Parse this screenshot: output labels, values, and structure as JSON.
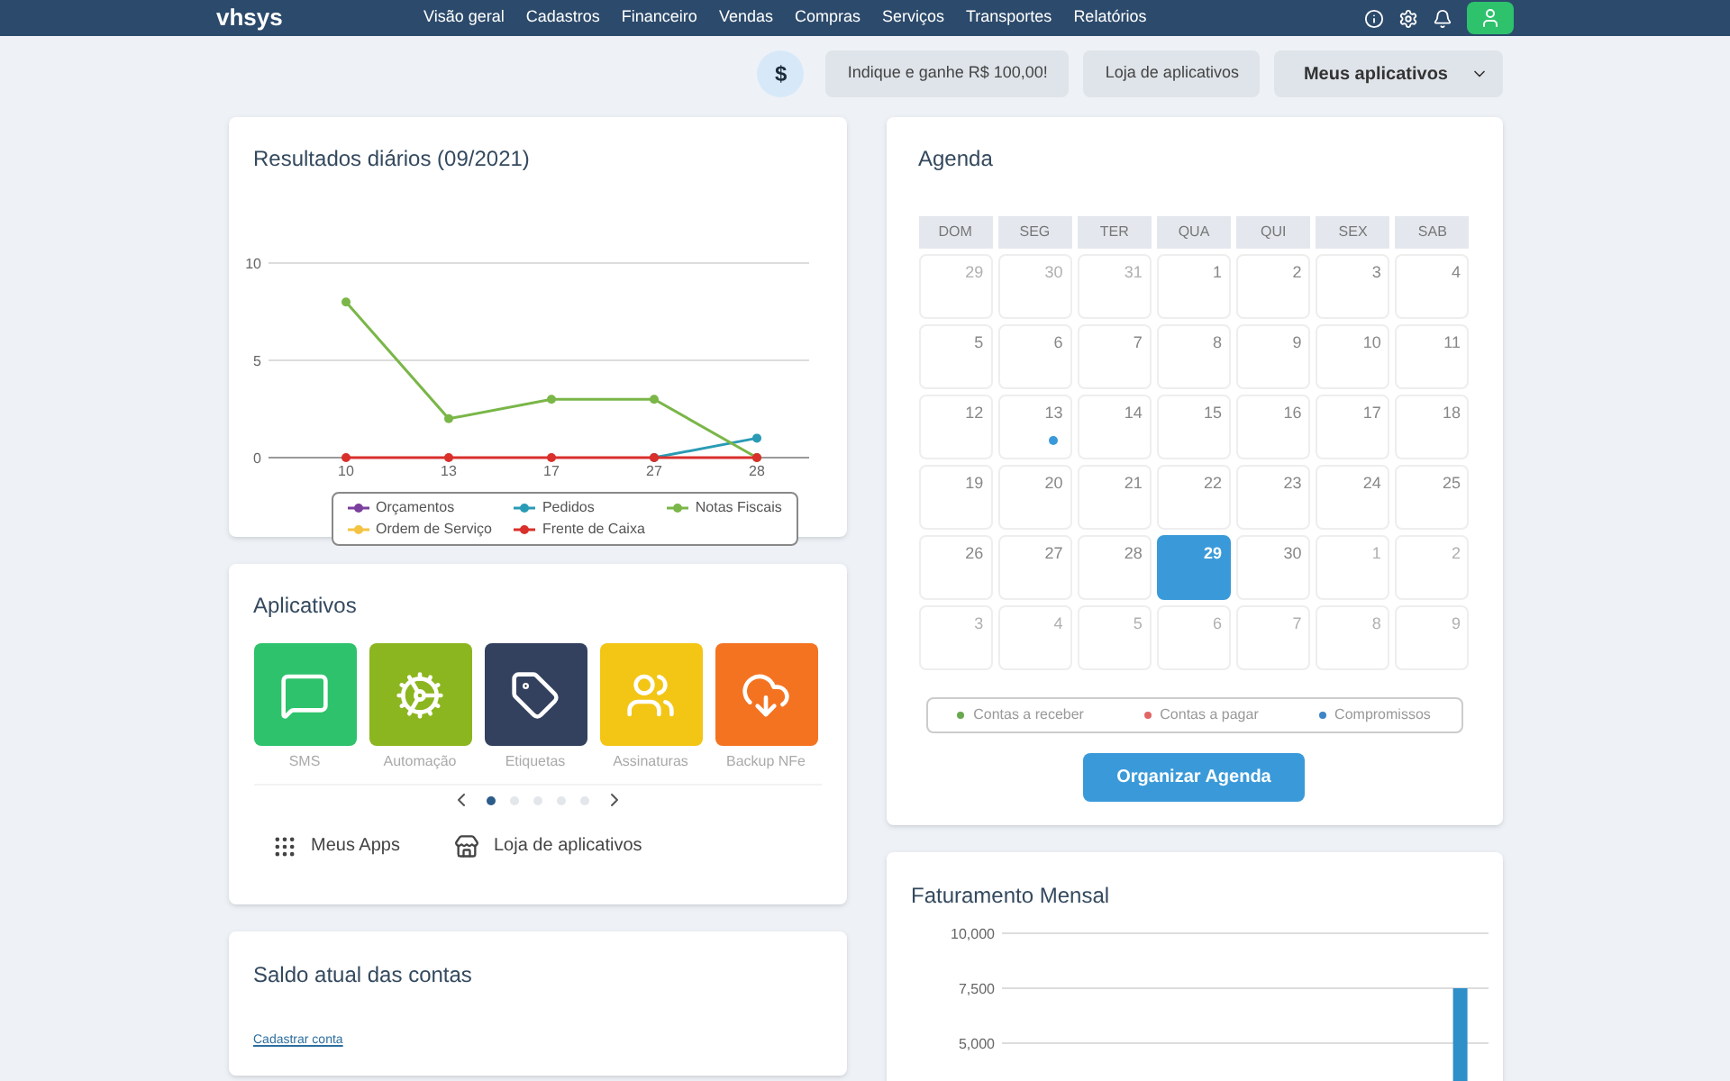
{
  "nav": {
    "logo": "vhsys",
    "items": [
      "Visão geral",
      "Cadastros",
      "Financeiro",
      "Vendas",
      "Compras",
      "Serviços",
      "Transportes",
      "Relatórios"
    ]
  },
  "toolbar": {
    "badge": "$",
    "buttons": [
      "Indique e ganhe R$ 100,00!",
      "Loja de aplicativos"
    ],
    "dropdown": "Meus aplicativos"
  },
  "daily": {
    "title": "Resultados diários (09/2021)",
    "chart_data": {
      "type": "line",
      "categories": [
        "10",
        "13",
        "17",
        "27",
        "28"
      ],
      "ylim": [
        0,
        10
      ],
      "yticks": [
        0,
        5,
        10
      ],
      "series": [
        {
          "name": "Orçamentos",
          "color": "#7b3f9e",
          "marker": "circle",
          "values": [
            null,
            null,
            null,
            null,
            null
          ]
        },
        {
          "name": "Pedidos",
          "color": "#2a9bb5",
          "marker": "circle",
          "values": [
            null,
            null,
            null,
            0,
            1
          ]
        },
        {
          "name": "Notas Fiscais",
          "color": "#7ab648",
          "marker": "circle",
          "values": [
            8,
            2,
            3,
            3,
            0
          ]
        },
        {
          "name": "Ordem de Serviço",
          "color": "#f5c342",
          "marker": "circle",
          "values": [
            null,
            null,
            null,
            null,
            null
          ]
        },
        {
          "name": "Frente de Caixa",
          "color": "#d9302c",
          "marker": "circle",
          "values": [
            0,
            0,
            0,
            0,
            0
          ]
        }
      ],
      "legend": "bottom"
    }
  },
  "apps": {
    "title": "Aplicativos",
    "items": [
      {
        "label": "SMS",
        "kind": "sms",
        "color": "#2dc26b"
      },
      {
        "label": "Automação",
        "kind": "automation",
        "color": "#8cb61f"
      },
      {
        "label": "Etiquetas",
        "kind": "labels",
        "color": "#33415f"
      },
      {
        "label": "Assinaturas",
        "kind": "subscriptions",
        "color": "#f3c515"
      },
      {
        "label": "Backup NFe",
        "kind": "backup",
        "color": "#f47321"
      }
    ],
    "pages": [
      {
        "selected": true
      },
      {
        "selected": false
      },
      {
        "selected": false
      },
      {
        "selected": false
      },
      {
        "selected": false
      }
    ],
    "links": [
      "Meus Apps",
      "Loja de aplicativos"
    ]
  },
  "balance": {
    "title": "Saldo atual das contas",
    "link": "Cadastrar conta"
  },
  "agenda": {
    "title": "Agenda",
    "weekdays": [
      "DOM",
      "SEG",
      "TER",
      "QUA",
      "QUI",
      "SEX",
      "SAB"
    ],
    "days": [
      {
        "day": "29",
        "muted": true,
        "selected": false
      },
      {
        "day": "30",
        "muted": true,
        "selected": false
      },
      {
        "day": "31",
        "muted": true,
        "selected": false
      },
      {
        "day": "1",
        "muted": false,
        "selected": false
      },
      {
        "day": "2",
        "muted": false,
        "selected": false
      },
      {
        "day": "3",
        "muted": false,
        "selected": false
      },
      {
        "day": "4",
        "muted": false,
        "selected": false
      },
      {
        "day": "5",
        "muted": false,
        "selected": false
      },
      {
        "day": "6",
        "muted": false,
        "selected": false
      },
      {
        "day": "7",
        "muted": false,
        "selected": false
      },
      {
        "day": "8",
        "muted": false,
        "selected": false
      },
      {
        "day": "9",
        "muted": false,
        "selected": false
      },
      {
        "day": "10",
        "muted": false,
        "selected": false
      },
      {
        "day": "11",
        "muted": false,
        "selected": false
      },
      {
        "day": "12",
        "muted": false,
        "selected": false
      },
      {
        "day": "13",
        "muted": false,
        "selected": false,
        "color": "#3a9ad9"
      },
      {
        "day": "14",
        "muted": false,
        "selected": false
      },
      {
        "day": "15",
        "muted": false,
        "selected": false
      },
      {
        "day": "16",
        "muted": false,
        "selected": false
      },
      {
        "day": "17",
        "muted": false,
        "selected": false
      },
      {
        "day": "18",
        "muted": false,
        "selected": false
      },
      {
        "day": "19",
        "muted": false,
        "selected": false
      },
      {
        "day": "20",
        "muted": false,
        "selected": false
      },
      {
        "day": "21",
        "muted": false,
        "selected": false
      },
      {
        "day": "22",
        "muted": false,
        "selected": false
      },
      {
        "day": "23",
        "muted": false,
        "selected": false
      },
      {
        "day": "24",
        "muted": false,
        "selected": false
      },
      {
        "day": "25",
        "muted": false,
        "selected": false
      },
      {
        "day": "26",
        "muted": false,
        "selected": false
      },
      {
        "day": "27",
        "muted": false,
        "selected": false
      },
      {
        "day": "28",
        "muted": false,
        "selected": false
      },
      {
        "day": "29",
        "muted": false,
        "selected": true
      },
      {
        "day": "30",
        "muted": false,
        "selected": false
      },
      {
        "day": "1",
        "muted": true,
        "selected": false
      },
      {
        "day": "2",
        "muted": true,
        "selected": false
      },
      {
        "day": "3",
        "muted": true,
        "selected": false
      },
      {
        "day": "4",
        "muted": true,
        "selected": false
      },
      {
        "day": "5",
        "muted": true,
        "selected": false
      },
      {
        "day": "6",
        "muted": true,
        "selected": false
      },
      {
        "day": "7",
        "muted": true,
        "selected": false
      },
      {
        "day": "8",
        "muted": true,
        "selected": false
      },
      {
        "day": "9",
        "muted": true,
        "selected": false
      }
    ],
    "legend": [
      {
        "label": "Contas a receber",
        "color": "#6aa84f"
      },
      {
        "label": "Contas a pagar",
        "color": "#e06666"
      },
      {
        "label": "Compromissos",
        "color": "#3d85c6"
      }
    ],
    "button": "Organizar Agenda"
  },
  "monthly": {
    "title": "Faturamento Mensal",
    "chart_data": {
      "type": "bar",
      "ylim": [
        0,
        10000
      ],
      "yticks": [
        {
          "value": 5000,
          "label": "5,000"
        },
        {
          "value": 7500,
          "label": "7,500"
        },
        {
          "value": 10000,
          "label": "10,000"
        }
      ],
      "values": [
        null,
        null,
        null,
        null,
        null,
        null,
        null,
        null,
        null,
        null,
        null,
        7500
      ]
    }
  }
}
